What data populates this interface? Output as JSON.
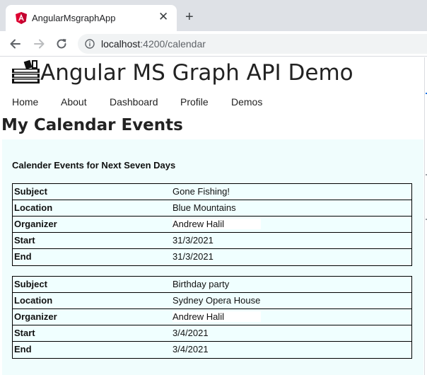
{
  "browser": {
    "tab_title": "AngularMsgraphApp",
    "url_host": "localhost",
    "url_path": ":4200/calendar",
    "icons": [
      "angular-favicon",
      "close-icon",
      "plus-icon",
      "back-arrow-icon",
      "forward-arrow-icon",
      "reload-icon",
      "info-icon"
    ]
  },
  "app": {
    "title": "Angular MS Graph API Demo",
    "logo_icon": "books-icon"
  },
  "nav": {
    "items": [
      "Home",
      "About",
      "Dashboard",
      "Profile",
      "Demos"
    ]
  },
  "page": {
    "title": "My Calendar Events",
    "section_title": "Calender Events for Next Seven Days"
  },
  "labels": {
    "subject": "Subject",
    "location": "Location",
    "organizer": "Organizer",
    "start": "Start",
    "end": "End"
  },
  "events": [
    {
      "subject": "Gone Fishing!",
      "location": "Blue Mountains",
      "organizer": "Andrew Halil",
      "start": "31/3/2021",
      "end": "31/3/2021"
    },
    {
      "subject": "Birthday party",
      "location": "Sydney Opera House",
      "organizer": "Andrew Halil",
      "start": "3/4/2021",
      "end": "3/4/2021"
    }
  ],
  "colors": {
    "angular_red": "#dd0031",
    "panel_bg": "#f0fdfd",
    "accent_blue": "#1a73e8"
  }
}
